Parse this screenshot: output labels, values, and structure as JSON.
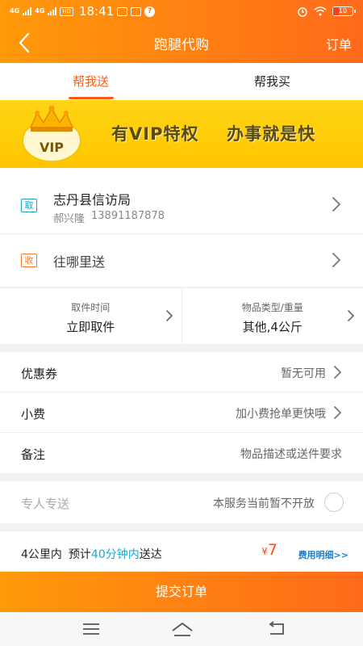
{
  "status_bar": {
    "network_1": "4G",
    "network_2": "4G",
    "hd_badge": "HD",
    "time": "18:41",
    "icon_1": "message-icon",
    "icon_2": "app-icon",
    "icon_3": "help-icon",
    "battery": "10"
  },
  "header": {
    "title": "跑腿代购",
    "right_action": "订单"
  },
  "tabs": [
    {
      "label": "帮我送",
      "active": true
    },
    {
      "label": "帮我买",
      "active": false
    }
  ],
  "banner": {
    "badge_text": "VIP",
    "slogan_part1": "有VIP特权",
    "slogan_part2": "办事就是快"
  },
  "pickup": {
    "tag": "取",
    "address": "志丹县信访局",
    "contact_name": "郝兴隆",
    "contact_phone": "13891187878"
  },
  "destination": {
    "tag": "收",
    "placeholder": "往哪里送"
  },
  "pickup_time": {
    "label": "取件时间",
    "value": "立即取件"
  },
  "item_type": {
    "label": "物品类型/重量",
    "value": "其他,4公斤"
  },
  "options": {
    "coupon": {
      "label": "优惠券",
      "value": "暂无可用"
    },
    "tip": {
      "label": "小费",
      "value": "加小费抢单更快哦"
    },
    "remark": {
      "label": "备注",
      "value": "物品描述或送件要求"
    }
  },
  "special_delivery": {
    "label": "专人专送",
    "note": "本服务当前暂不开放"
  },
  "summary": {
    "distance": "4公里内",
    "eta_prefix": "预计",
    "eta_highlight": "40分钟内",
    "eta_suffix": "送达",
    "currency": "¥",
    "price": "7",
    "fee_detail": "费用明细>>"
  },
  "submit_label": "提交订单",
  "system_nav": {
    "menu": "menu-icon",
    "home": "home-icon",
    "back": "back-icon"
  },
  "colors": {
    "brand_orange": "#ff6a1a",
    "brand_gradient_start": "#ff9a0a",
    "banner_yellow": "#ffc600",
    "highlight_blue": "#1aa7d6",
    "price_red": "#ff4a1a"
  }
}
